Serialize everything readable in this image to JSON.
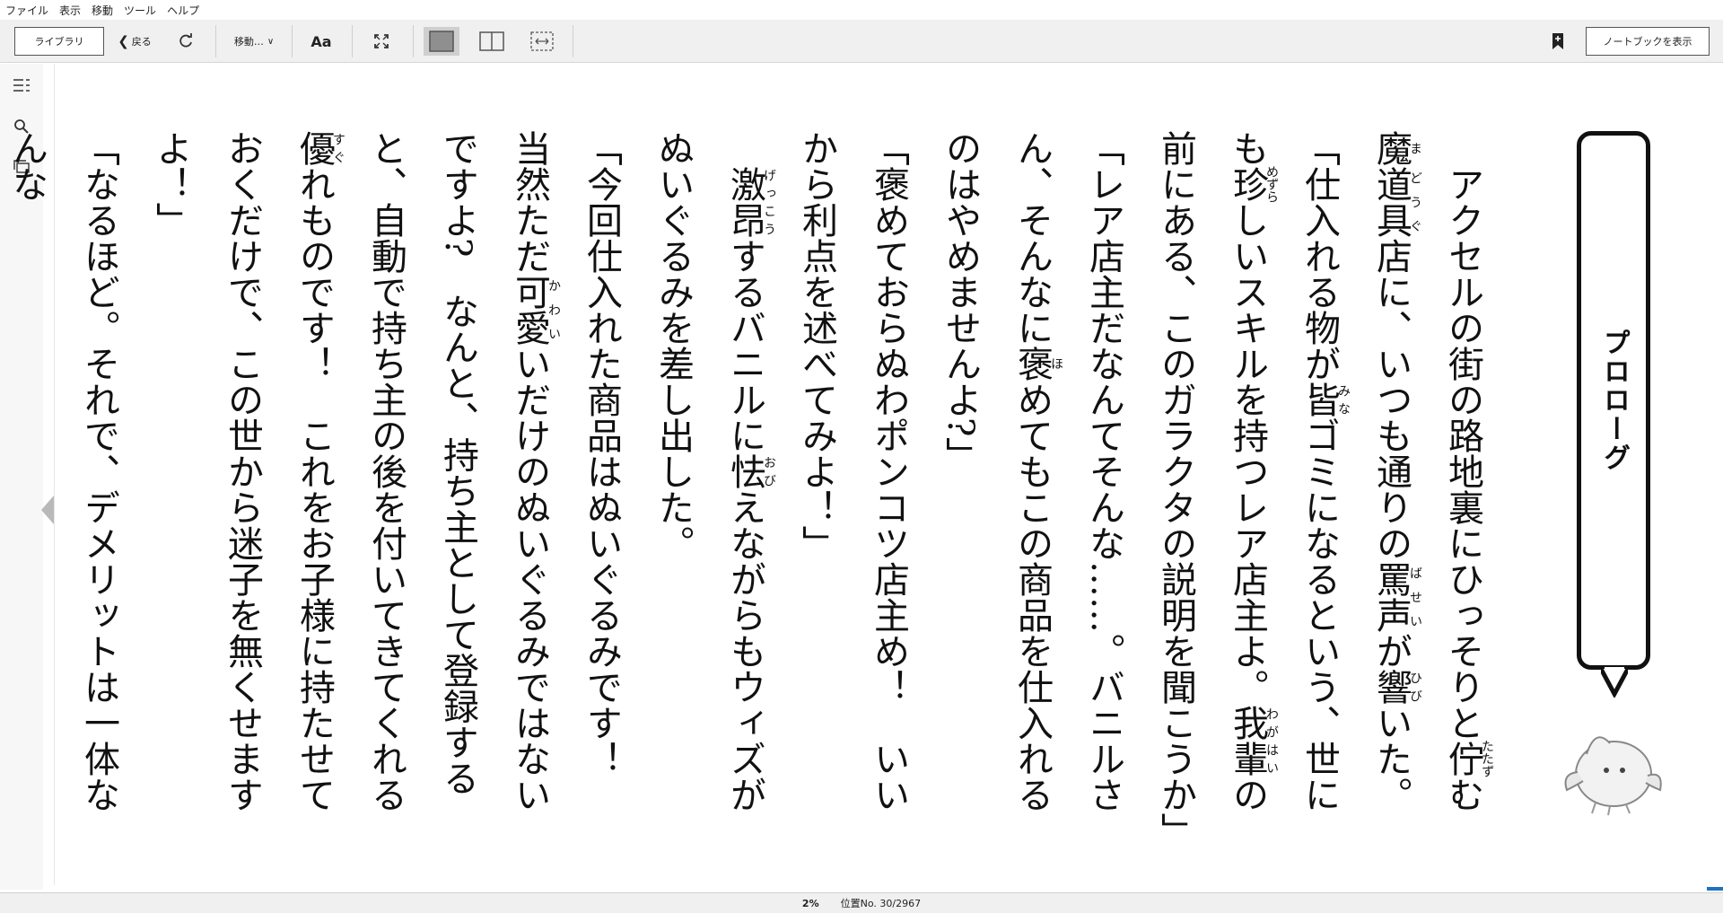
{
  "menu": [
    "ファイル",
    "表示",
    "移動",
    "ツール",
    "ヘルプ"
  ],
  "toolbar": {
    "library_label": "ライブラリ",
    "back_label": "戻る",
    "goto_label": "移動…",
    "font_label": "Aa",
    "notebook_label": "ノートブックを表示"
  },
  "chapter_heading": "プロローグ",
  "status": {
    "percent": "2%",
    "location": "位置No. 30/2967"
  },
  "colors": {
    "toolbar_bg": "#f0f0f0",
    "text": "#111111",
    "progress": "#1e73be"
  }
}
